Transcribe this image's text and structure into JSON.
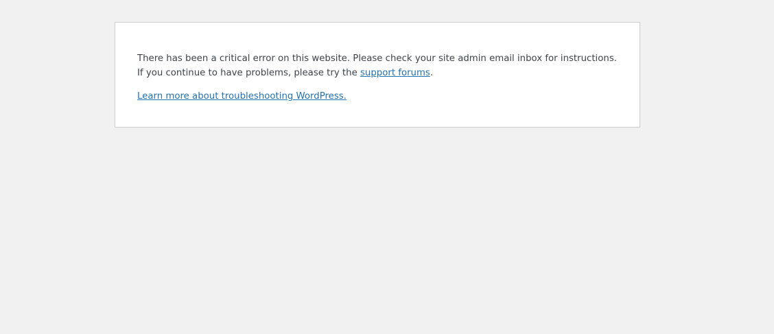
{
  "error": {
    "message_prefix": "There has been a critical error on this website. Please check your site admin email inbox for instructions. If you continue to have problems, please try the ",
    "support_link_text": "support forums",
    "message_suffix": ".",
    "troubleshoot_link_text": "Learn more about troubleshooting WordPress."
  },
  "colors": {
    "page_background": "#f1f1f1",
    "box_background": "#ffffff",
    "box_border": "#cccccc",
    "text": "#3c434a",
    "link": "#2271b1"
  }
}
